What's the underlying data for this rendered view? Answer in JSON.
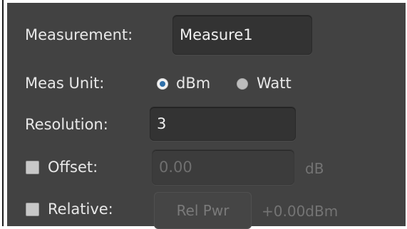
{
  "measurement": {
    "label": "Measurement:",
    "value": "Measure1"
  },
  "meas_unit": {
    "label": "Meas Unit:",
    "options": [
      {
        "label": "dBm",
        "selected": true
      },
      {
        "label": "Watt",
        "selected": false
      }
    ]
  },
  "resolution": {
    "label": "Resolution:",
    "value": "3"
  },
  "offset": {
    "label": "Offset:",
    "checked": false,
    "value": "0.00",
    "unit": "dB"
  },
  "relative": {
    "label": "Relative:",
    "checked": false,
    "button_label": "Rel Pwr",
    "reading": "+0.00dBm"
  },
  "colors": {
    "panel_bg": "#424242",
    "radio_accent": "#2f6fa8"
  }
}
